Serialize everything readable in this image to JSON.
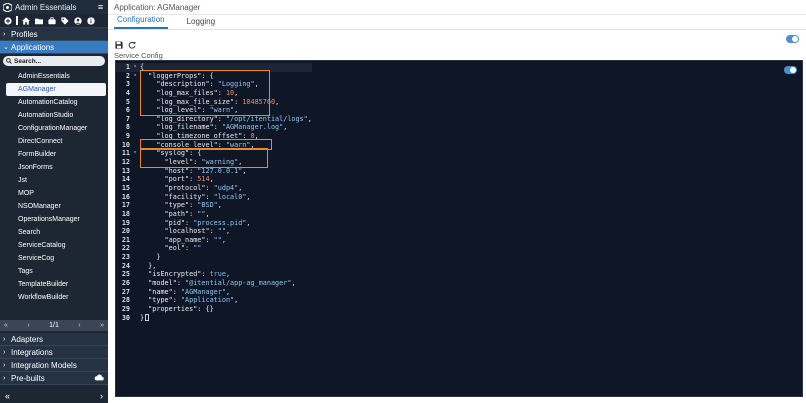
{
  "sidebar": {
    "title": "Admin Essentials",
    "menu_icon": "hamburger-icon",
    "toolbar_icons": [
      "add-icon",
      "home-icon",
      "folder-icon",
      "briefcase-icon",
      "tag-icon",
      "user-icon",
      "info-icon"
    ],
    "sections_top": [
      {
        "label": "Profiles",
        "icon": "chevron-right-icon"
      },
      {
        "label": "Applications",
        "icon": "chevron-down-icon"
      }
    ],
    "search_placeholder": "Search...",
    "applications": [
      "AdminEssentials",
      "AGManager",
      "AutomationCatalog",
      "AutomationStudio",
      "ConfigurationManager",
      "DirectConnect",
      "FormBuilder",
      "JsonForms",
      "Jst",
      "MOP",
      "NSOManager",
      "OperationsManager",
      "Search",
      "ServiceCatalog",
      "ServiceCog",
      "Tags",
      "TemplateBuilder",
      "WorkflowBuilder"
    ],
    "selected_application": "AGManager",
    "pager": {
      "first": "«",
      "prev": "‹",
      "page": "1/1",
      "next": "›",
      "last": "»"
    },
    "sections_bottom": [
      {
        "label": "Adapters",
        "icon": "chevron-right-icon"
      },
      {
        "label": "Integrations",
        "icon": "chevron-right-icon"
      },
      {
        "label": "Integration Models",
        "icon": "chevron-right-icon"
      },
      {
        "label": "Pre-builts",
        "icon": "chevron-right-icon"
      }
    ],
    "cloud_icon": "cloud-icon",
    "footer": {
      "collapse": "«",
      "expand": "›"
    }
  },
  "main": {
    "header": "Application: AGManager",
    "tabs": [
      {
        "label": "Configuration",
        "active": true
      },
      {
        "label": "Logging",
        "active": false
      }
    ],
    "toolbar": {
      "save_icon": "save-icon",
      "refresh_icon": "refresh-icon",
      "toggle_state": "on"
    },
    "section_label": "Service Config",
    "accent_color": "#2e74b5",
    "highlight_color": "#e6892e"
  },
  "editor": {
    "lines": [
      [
        [
          "p",
          "{"
        ]
      ],
      [
        [
          "k",
          "  \"loggerProps\""
        ],
        [
          "p",
          ": {"
        ]
      ],
      [
        [
          "k",
          "    \"description\""
        ],
        [
          "p",
          ": "
        ],
        [
          "s",
          "\"Logging\""
        ],
        [
          "p",
          ","
        ]
      ],
      [
        [
          "k",
          "    \"log_max_files\""
        ],
        [
          "p",
          ": "
        ],
        [
          "n",
          "10"
        ],
        [
          "p",
          ","
        ]
      ],
      [
        [
          "k",
          "    \"log_max_file_size\""
        ],
        [
          "p",
          ": "
        ],
        [
          "n",
          "10485760"
        ],
        [
          "p",
          ","
        ]
      ],
      [
        [
          "k",
          "    \"log_level\""
        ],
        [
          "p",
          ": "
        ],
        [
          "s",
          "\"warn\""
        ],
        [
          "p",
          ","
        ]
      ],
      [
        [
          "k",
          "    \"log_directory\""
        ],
        [
          "p",
          ": "
        ],
        [
          "s",
          "\"/opt/itential/logs\""
        ],
        [
          "p",
          ","
        ]
      ],
      [
        [
          "k",
          "    \"log_filename\""
        ],
        [
          "p",
          ": "
        ],
        [
          "s",
          "\"AGManager.log\""
        ],
        [
          "p",
          ","
        ]
      ],
      [
        [
          "k",
          "    \"log_timezone_offset\""
        ],
        [
          "p",
          ": "
        ],
        [
          "n",
          "0"
        ],
        [
          "p",
          ","
        ]
      ],
      [
        [
          "k",
          "    \"console_level\""
        ],
        [
          "p",
          ": "
        ],
        [
          "s",
          "\"warn\""
        ],
        [
          "p",
          ","
        ]
      ],
      [
        [
          "k",
          "    \"syslog\""
        ],
        [
          "p",
          ": {"
        ]
      ],
      [
        [
          "k",
          "      \"level\""
        ],
        [
          "p",
          ": "
        ],
        [
          "s",
          "\"warning\""
        ],
        [
          "p",
          ","
        ]
      ],
      [
        [
          "k",
          "      \"host\""
        ],
        [
          "p",
          ": "
        ],
        [
          "s",
          "\"127.0.0.1\""
        ],
        [
          "p",
          ","
        ]
      ],
      [
        [
          "k",
          "      \"port\""
        ],
        [
          "p",
          ": "
        ],
        [
          "n",
          "514"
        ],
        [
          "p",
          ","
        ]
      ],
      [
        [
          "k",
          "      \"protocol\""
        ],
        [
          "p",
          ": "
        ],
        [
          "s",
          "\"udp4\""
        ],
        [
          "p",
          ","
        ]
      ],
      [
        [
          "k",
          "      \"facility\""
        ],
        [
          "p",
          ": "
        ],
        [
          "s",
          "\"local0\""
        ],
        [
          "p",
          ","
        ]
      ],
      [
        [
          "k",
          "      \"type\""
        ],
        [
          "p",
          ": "
        ],
        [
          "s",
          "\"BSD\""
        ],
        [
          "p",
          ","
        ]
      ],
      [
        [
          "k",
          "      \"path\""
        ],
        [
          "p",
          ": "
        ],
        [
          "s",
          "\"\""
        ],
        [
          "p",
          ","
        ]
      ],
      [
        [
          "k",
          "      \"pid\""
        ],
        [
          "p",
          ": "
        ],
        [
          "s",
          "\"process.pid\""
        ],
        [
          "p",
          ","
        ]
      ],
      [
        [
          "k",
          "      \"localhost\""
        ],
        [
          "p",
          ": "
        ],
        [
          "s",
          "\"\""
        ],
        [
          "p",
          ","
        ]
      ],
      [
        [
          "k",
          "      \"app_name\""
        ],
        [
          "p",
          ": "
        ],
        [
          "s",
          "\"\""
        ],
        [
          "p",
          ","
        ]
      ],
      [
        [
          "k",
          "      \"eol\""
        ],
        [
          "p",
          ": "
        ],
        [
          "s",
          "\"\""
        ]
      ],
      [
        [
          "p",
          "    }"
        ]
      ],
      [
        [
          "p",
          "  },"
        ]
      ],
      [
        [
          "k",
          "  \"isEncrypted\""
        ],
        [
          "p",
          ": "
        ],
        [
          "b",
          "true"
        ],
        [
          "p",
          ","
        ]
      ],
      [
        [
          "k",
          "  \"model\""
        ],
        [
          "p",
          ": "
        ],
        [
          "s",
          "\"@itential/app-ag_manager\""
        ],
        [
          "p",
          ","
        ]
      ],
      [
        [
          "k",
          "  \"name\""
        ],
        [
          "p",
          ": "
        ],
        [
          "s",
          "\"AGManager\""
        ],
        [
          "p",
          ","
        ]
      ],
      [
        [
          "k",
          "  \"type\""
        ],
        [
          "p",
          ": "
        ],
        [
          "s",
          "\"Application\""
        ],
        [
          "p",
          ","
        ]
      ],
      [
        [
          "k",
          "  \"properties\""
        ],
        [
          "p",
          ": {}"
        ]
      ],
      [
        [
          "p",
          "}"
        ]
      ]
    ],
    "fold_lines": [
      1,
      2,
      11
    ],
    "highlight_boxes": [
      {
        "from_line": 2,
        "to_line": 6
      },
      {
        "from_line": 10,
        "to_line": 10
      },
      {
        "from_line": 11,
        "to_line": 12
      }
    ]
  }
}
